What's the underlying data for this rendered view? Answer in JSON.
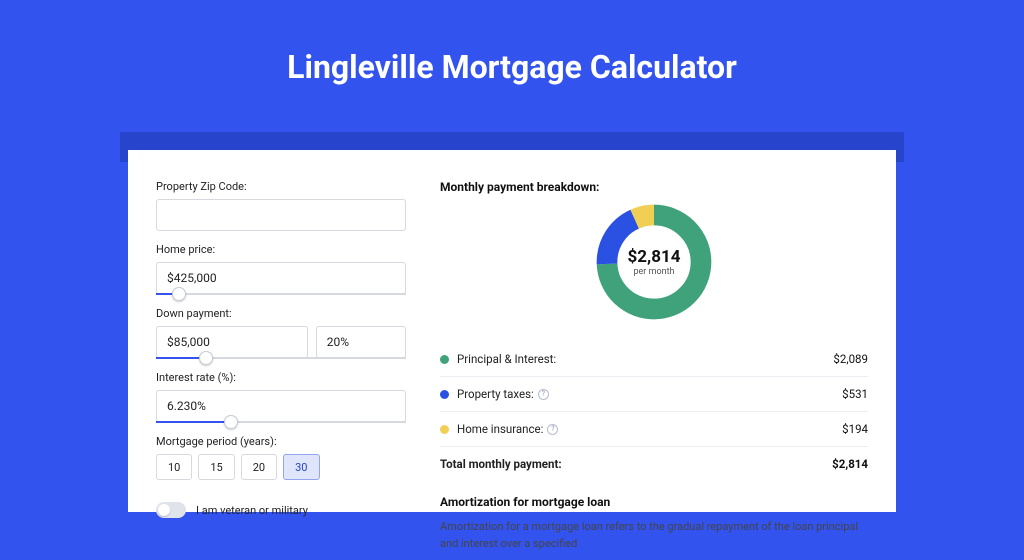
{
  "page_title": "Lingleville Mortgage Calculator",
  "colors": {
    "accent": "#3353ef",
    "green": "#3fa27a",
    "blue": "#2b51e3",
    "yellow": "#f1cf54"
  },
  "form": {
    "zip": {
      "label": "Property Zip Code:",
      "value": ""
    },
    "price": {
      "label": "Home price:",
      "value": "$425,000",
      "slider_pct": 9
    },
    "down": {
      "label": "Down payment:",
      "amount": "$85,000",
      "percent": "20%",
      "slider_pct": 20
    },
    "rate": {
      "label": "Interest rate (%):",
      "value": "6.230%",
      "slider_pct": 30
    },
    "period": {
      "label": "Mortgage period (years):",
      "options": [
        "10",
        "15",
        "20",
        "30"
      ],
      "selected": "30"
    },
    "veteran": {
      "label": "I am veteran or military",
      "value": false
    }
  },
  "breakdown": {
    "title": "Monthly payment breakdown:",
    "center_amount": "$2,814",
    "center_sub": "per month",
    "items": [
      {
        "label": "Principal & Interest:",
        "value": "$2,089",
        "has_info": false
      },
      {
        "label": "Property taxes:",
        "value": "$531",
        "has_info": true
      },
      {
        "label": "Home insurance:",
        "value": "$194",
        "has_info": true
      }
    ],
    "total": {
      "label": "Total monthly payment:",
      "value": "$2,814"
    }
  },
  "chart_data": {
    "type": "pie",
    "title": "Monthly payment breakdown",
    "series": [
      {
        "name": "Principal & Interest",
        "value": 2089,
        "color": "#3fa27a"
      },
      {
        "name": "Property taxes",
        "value": 531,
        "color": "#2b51e3"
      },
      {
        "name": "Home insurance",
        "value": 194,
        "color": "#f1cf54"
      }
    ],
    "total": 2814
  },
  "amortization": {
    "title": "Amortization for mortgage loan",
    "body": "Amortization for a mortgage loan refers to the gradual repayment of the loan principal and interest over a specified"
  }
}
